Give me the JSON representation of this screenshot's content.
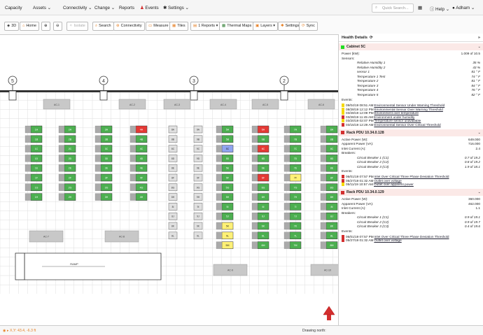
{
  "nav": {
    "items": [
      "Capacity",
      "Assets",
      "Connectivity",
      "Change",
      "Reports",
      "Events",
      "Settings"
    ],
    "search_placeholder": "Quick Search...",
    "help": "Help",
    "user": "Adham"
  },
  "toolbar": {
    "buttons": [
      "3D",
      "Home",
      "",
      "",
      "Isolate",
      "Search",
      "Connectivity",
      "Measure",
      "Tiles",
      "1 Reports",
      "Thermal Maps",
      "Layers",
      "Settings",
      "Sync"
    ]
  },
  "floor": {
    "columns": [
      "5",
      "4",
      "3",
      "2"
    ],
    "rows_a": [
      "1A",
      "1B",
      "1C",
      "1D",
      "1E",
      "1F",
      "1G",
      "1H"
    ],
    "rows_b": [
      "2A",
      "2B",
      "2C",
      "2D",
      "2E",
      "2F",
      "2G",
      "2H"
    ],
    "rows_c": [
      "3A",
      "3B",
      "3C",
      "3D",
      "3E",
      "3F",
      "3G",
      "3H"
    ],
    "rows_d": [
      "4A",
      "4B",
      "4C",
      "4D",
      "4E",
      "4F",
      "4G",
      "4H"
    ],
    "rows_8": [
      "8A",
      "8B",
      "8C",
      "8D",
      "8E",
      "8F",
      "8G",
      "8H",
      "8I",
      "8J",
      "8K",
      "8L"
    ],
    "rows_9": [
      "9A",
      "9B",
      "9C",
      "9D",
      "9E",
      "9F",
      "9G",
      "9H",
      "9I",
      "9J",
      "9K",
      "9L"
    ],
    "rows_5": [
      "5A",
      "5B",
      "5C",
      "5D",
      "5E",
      "5F",
      "5G",
      "5H",
      "5I",
      "5J",
      "5K",
      "5L",
      "5M"
    ],
    "rows_6": [
      "6A",
      "6B",
      "6C",
      "6D",
      "6E",
      "6F",
      "6G",
      "6H",
      "6I",
      "6J",
      "6K",
      "6L",
      "6M"
    ],
    "rows_7": [
      "7A",
      "7B",
      "7C",
      "7D",
      "7E",
      "7F",
      "7G",
      "7H",
      "7I",
      "7J",
      "7K",
      "7L",
      "7M"
    ],
    "rows_edge": [
      "8A",
      "8B",
      "8C",
      "8D",
      "8E",
      "8F",
      "8G",
      "8H",
      "8I",
      "8J",
      "8K",
      "8L",
      "8M"
    ],
    "units": [
      "AC-1",
      "AC-2",
      "AC-3",
      "AC-4",
      "AC-5",
      "AC-6",
      "AC-7",
      "AC-8",
      "AC-9",
      "AC-10"
    ],
    "ramp": "RAMP"
  },
  "status": {
    "coords": "X,Y: 43.4, -6.3 ft",
    "drawing": "Drawing north:"
  },
  "health": {
    "title": "Health Details",
    "cabinet": {
      "name": "Cabinet 5C",
      "power_label": "Power (kW):",
      "power": "1.009 of 10.5",
      "sensors_label": "Sensors:",
      "sensors": [
        [
          "Relative Humidity 1",
          "35 %"
        ],
        [
          "Relative Humidity 2",
          "43 %"
        ],
        [
          "sensor 1",
          "81 ° F"
        ],
        [
          "Temperature 1 Test",
          "74 ° F"
        ],
        [
          "Temperature 2",
          "81 ° F"
        ],
        [
          "Temperature 3",
          "84 ° F"
        ],
        [
          "Temperature 4",
          "76 ° F"
        ],
        [
          "Temperature 5",
          "82 ° F"
        ]
      ],
      "events_label": "Events:",
      "events": [
        [
          "#f5d90a",
          "09/04/19 08:51 AM",
          "Environmental Sensor Under Warning Threshold"
        ],
        [
          "#f5d90a",
          "08/28/19 12:12 PM",
          "Environmental Sensor Over Warning Threshold"
        ],
        [
          "#f5d90a",
          "03/28/19 12:09 PM",
          "Environment over temperature"
        ],
        [
          "#d32f2f",
          "03/28/19 11:45 AM",
          "Environment under humidity"
        ],
        [
          "#f5d90a",
          "03/20/19 02:07 PM",
          "Temperature sensor unavailable"
        ],
        [
          "#d32f2f",
          "03/15/19 12:29 AM",
          "Environmental Sensor Over Critical Threshold"
        ]
      ]
    },
    "pdus": [
      {
        "name": "Rack PDU 10.34.0.128",
        "rows": [
          [
            "Active Power (W):",
            "649.000"
          ],
          [
            "Apparent Power (VA):",
            "716.000"
          ],
          [
            "Inlet Current (A):",
            "2.4"
          ]
        ],
        "breakers_label": "Breakers:",
        "breakers": [
          [
            "Circuit Breaker 1 (C1)",
            "0.7 of 19.2"
          ],
          [
            "Circuit Breaker 2 (C2)",
            "0.8 of 19.2"
          ],
          [
            "Circuit Breaker 3 (C3)",
            "1.9 of 18.1"
          ]
        ],
        "events_label": "Events:",
        "events": [
          [
            "#d32f2f",
            "06/01/19 07:57 PM",
            "Inlet Over Critical Three Phase Deviation Threshold"
          ],
          [
            "#d32f2f",
            "05/27/19 01:32 AM",
            "Outlet over voltage"
          ],
          [
            "#f5d90a",
            "05/11/19 10:57 AM",
            "Outlet over apparent power"
          ]
        ]
      },
      {
        "name": "Rack PDU 10.34.0.129",
        "rows": [
          [
            "Active Power (W):",
            "360.000"
          ],
          [
            "Apparent Power (VA):",
            "462.000"
          ],
          [
            "Inlet Current (A):",
            "1.1"
          ]
        ],
        "breakers_label": "Breakers:",
        "breakers": [
          [
            "Circuit Breaker 1 (C1)",
            "0.9 of 19.1"
          ],
          [
            "Circuit Breaker 2 (C2)",
            "0.9 of 19.7"
          ],
          [
            "Circuit Breaker 3 (C3)",
            "0.4 of 19.6"
          ]
        ],
        "events_label": "Events:",
        "events": [
          [
            "#d32f2f",
            "06/01/19 07:57 PM",
            "Inlet Over Critical Three Phase Deviation Threshold"
          ],
          [
            "#d32f2f",
            "05/27/19 01:32 AM",
            "Outlet over voltage"
          ]
        ]
      }
    ]
  },
  "colors": {
    "ok": "#4caf50",
    "critical": "#e53935",
    "warning": "#fff176",
    "selected": "#90a4f0",
    "empty": "#e0e0e0"
  }
}
